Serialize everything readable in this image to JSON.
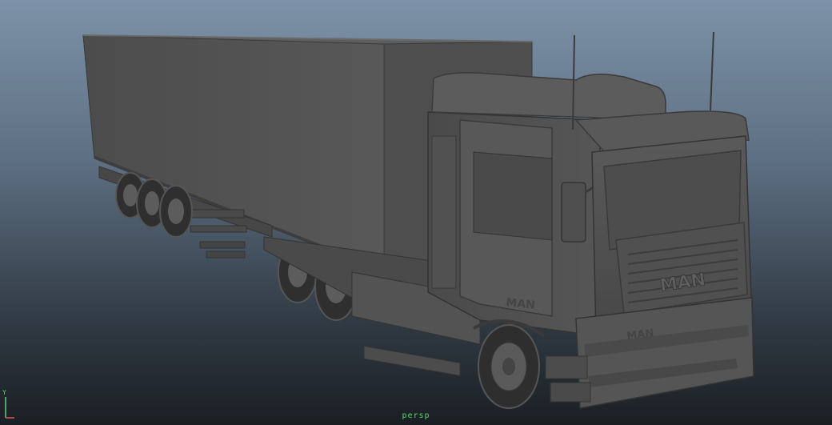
{
  "viewport": {
    "camera_name": "persp",
    "grille_logo": "MAN",
    "door_logo": "MAN",
    "bumper_logo": "MAN",
    "axis_label": "Y",
    "colors": {
      "background_top": "#7d92a8",
      "background_bottom": "#1a1f24",
      "model_gray": "#545454",
      "camera_label": "#58d66a"
    }
  }
}
